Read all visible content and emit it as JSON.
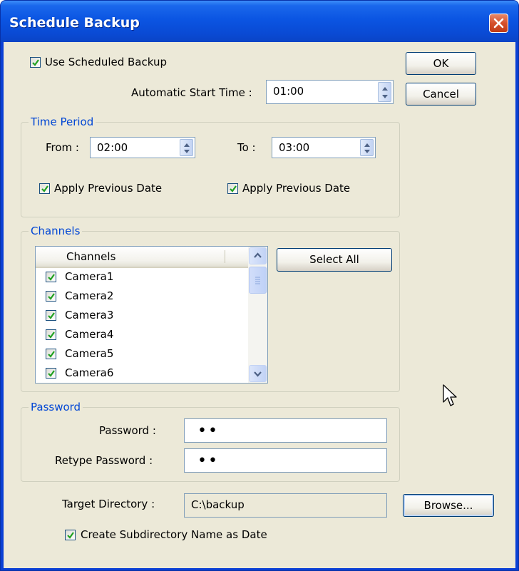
{
  "window": {
    "title": "Schedule Backup"
  },
  "scheduled": {
    "checkbox_label": "Use Scheduled Backup",
    "checked": true
  },
  "start_time": {
    "label": "Automatic Start Time :",
    "value": "01:00"
  },
  "buttons": {
    "ok": "OK",
    "cancel": "Cancel",
    "select_all": "Select All",
    "browse": "Browse..."
  },
  "time_period": {
    "legend": "Time Period",
    "from_label": "From :",
    "from_value": "02:00",
    "to_label": "To :",
    "to_value": "03:00",
    "from_apply_previous": "Apply Previous Date",
    "to_apply_previous": "Apply Previous Date"
  },
  "channels": {
    "legend": "Channels",
    "column_header": "Channels",
    "items": [
      {
        "label": "Camera1",
        "checked": true
      },
      {
        "label": "Camera2",
        "checked": true
      },
      {
        "label": "Camera3",
        "checked": true
      },
      {
        "label": "Camera4",
        "checked": true
      },
      {
        "label": "Camera5",
        "checked": true
      },
      {
        "label": "Camera6",
        "checked": true
      }
    ]
  },
  "password": {
    "legend": "Password",
    "password_label": "Password :",
    "password_value": "••",
    "retype_label": "Retype Password :",
    "retype_value": "••"
  },
  "target": {
    "label": "Target Directory :",
    "value": "C:\\backup",
    "subdir_label": "Create Subdirectory Name as Date",
    "subdir_checked": true
  },
  "colors": {
    "title_blue": "#0a4ad4",
    "group_legend": "#0046d5",
    "dialog_bg": "#ece9d8",
    "close_red": "#d5502c"
  }
}
